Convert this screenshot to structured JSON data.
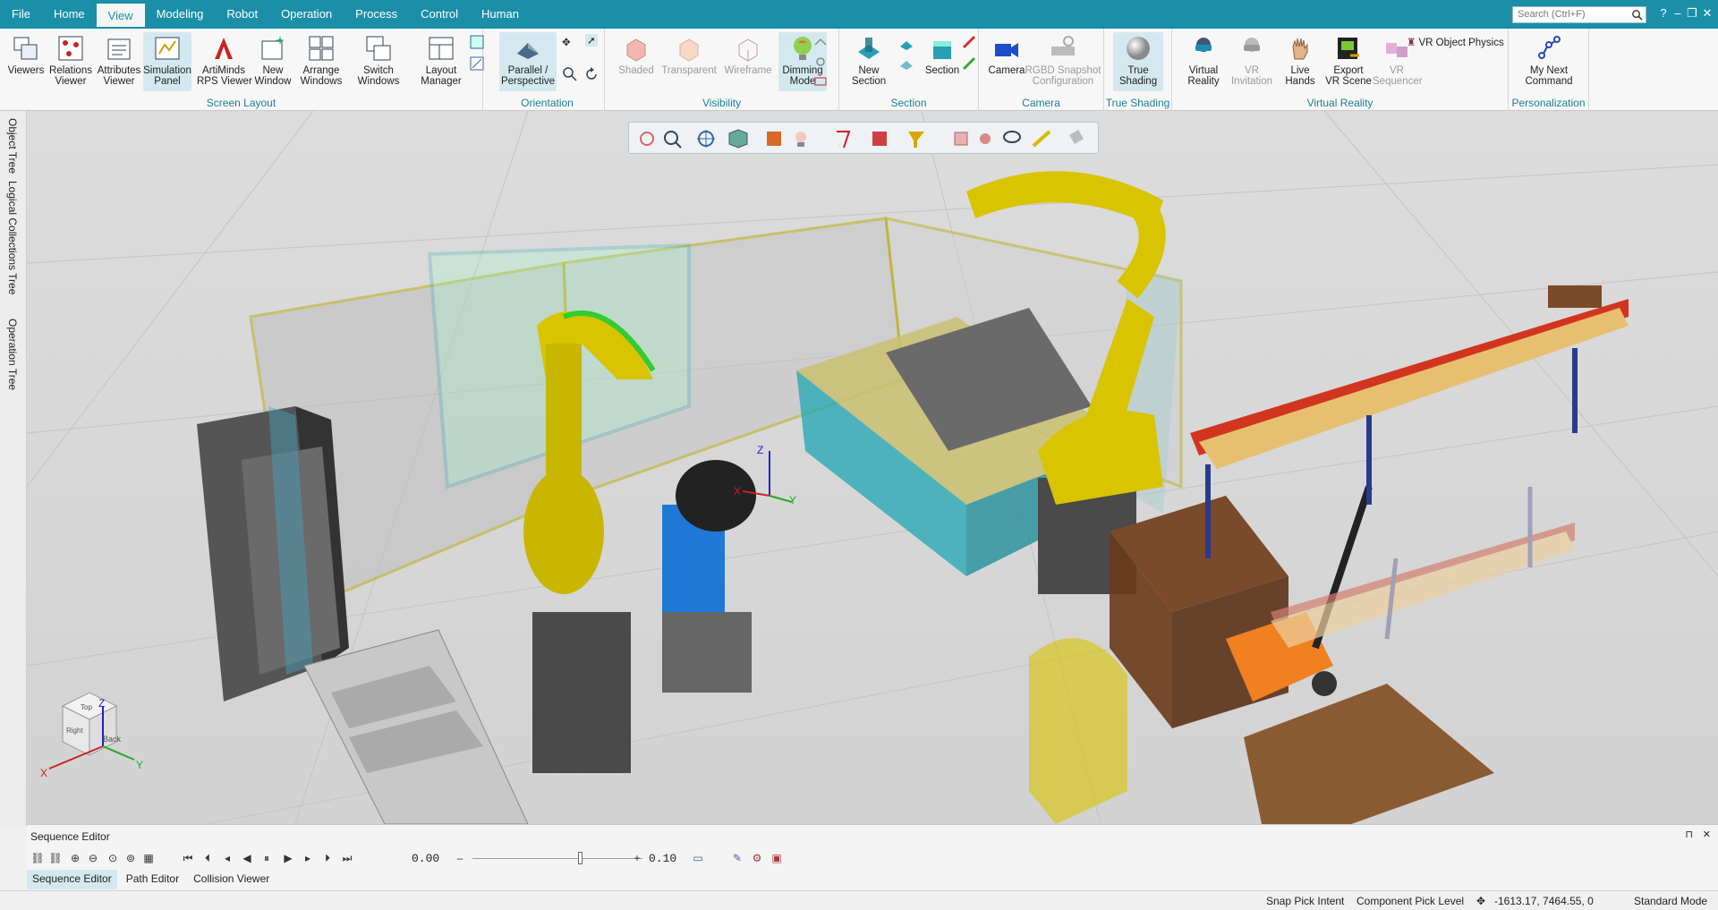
{
  "menu": {
    "items": [
      "File",
      "Home",
      "View",
      "Modeling",
      "Robot",
      "Operation",
      "Process",
      "Control",
      "Human"
    ],
    "active": "View"
  },
  "search": {
    "placeholder": "Search (Ctrl+F)"
  },
  "window_controls": {
    "help": "?",
    "collapse": "⌃",
    "minimize": "–",
    "restore": "❐",
    "close": "✕"
  },
  "ribbon": {
    "screen_layout": {
      "label": "Screen Layout",
      "buttons": [
        "Viewers",
        "Relations\nViewer",
        "Attributes\nViewer",
        "Simulation\nPanel",
        "ArtiMinds\nRPS Viewer",
        "New\nWindow",
        "Arrange\nWindows",
        "Switch\nWindows",
        "Layout\nManager"
      ]
    },
    "orientation": {
      "label": "Orientation",
      "buttons": [
        "Parallel /\nPerspective"
      ]
    },
    "visibility": {
      "label": "Visibility",
      "buttons": [
        "Shaded",
        "Transparent",
        "Wireframe",
        "Dimming\nMode"
      ]
    },
    "section": {
      "label": "Section",
      "buttons": [
        "New\nSection",
        "Section"
      ]
    },
    "camera": {
      "label": "Camera",
      "buttons": [
        "Camera",
        "RGBD Snapshot\nConfiguration"
      ]
    },
    "true_shading": {
      "label": "True Shading",
      "buttons": [
        "True\nShading"
      ]
    },
    "virtual_reality": {
      "label": "Virtual Reality",
      "buttons": [
        "Virtual\nReality",
        "VR\nInvitation",
        "Live\nHands",
        "Export\nVR Scene",
        "VR\nSequencer"
      ],
      "vr_object_physics": "VR Object Physics"
    },
    "personalization": {
      "label": "Personalization",
      "buttons": [
        "My Next\nCommand"
      ]
    }
  },
  "sidebar": {
    "tabs": [
      "Object Tree",
      "Logical Collections Tree",
      "Operation Tree"
    ]
  },
  "viewport": {
    "axis_labels": {
      "x": "X",
      "y": "Y",
      "z": "Z"
    },
    "cube_faces": {
      "top": "Top",
      "back": "Back",
      "right": "Right"
    }
  },
  "sequence_editor": {
    "title": "Sequence Editor",
    "time": "0.00",
    "speed": "0.10",
    "tabs": [
      "Sequence Editor",
      "Path Editor",
      "Collision Viewer"
    ],
    "active_tab": "Sequence Editor",
    "pin": "⊓",
    "close": "✕"
  },
  "status": {
    "snap_pick_intent": "Snap Pick Intent",
    "component_pick_level": "Component Pick Level",
    "coordinates": "-1613.17, 7464.55, 0",
    "mode": "Standard Mode"
  },
  "colors": {
    "brand": "#1b8fa8",
    "robot_yellow": "#d8c400",
    "fence_cyan": "#2aa9b5"
  }
}
